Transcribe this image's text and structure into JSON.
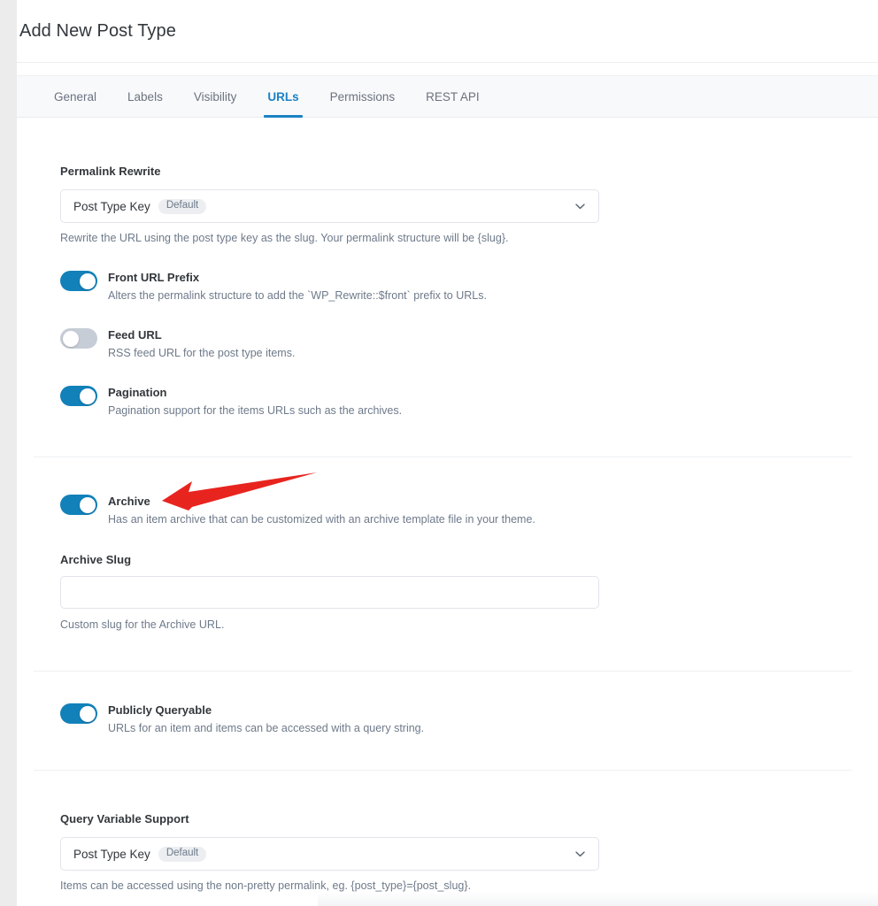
{
  "header": {
    "title": "Add New Post Type"
  },
  "tabs": [
    {
      "label": "General",
      "active": false
    },
    {
      "label": "Labels",
      "active": false
    },
    {
      "label": "Visibility",
      "active": false
    },
    {
      "label": "URLs",
      "active": true
    },
    {
      "label": "Permissions",
      "active": false
    },
    {
      "label": "REST API",
      "active": false
    }
  ],
  "fields": {
    "permalink_rewrite": {
      "label": "Permalink Rewrite",
      "value": "Post Type Key",
      "badge": "Default",
      "helper": "Rewrite the URL using the post type key as the slug. Your permalink structure will be {slug}.",
      "chevron_icon": "chevron-down-icon"
    },
    "front_url_prefix": {
      "label": "Front URL Prefix",
      "description": "Alters the permalink structure to add the `WP_Rewrite::$front` prefix to URLs.",
      "state": "on"
    },
    "feed_url": {
      "label": "Feed URL",
      "description": "RSS feed URL for the post type items.",
      "state": "off"
    },
    "pagination": {
      "label": "Pagination",
      "description": "Pagination support for the items URLs such as the archives.",
      "state": "on"
    },
    "archive": {
      "label": "Archive",
      "description": "Has an item archive that can be customized with an archive template file in your theme.",
      "state": "on"
    },
    "archive_slug": {
      "label": "Archive Slug",
      "value": "",
      "placeholder": "",
      "helper": "Custom slug for the Archive URL."
    },
    "publicly_queryable": {
      "label": "Publicly Queryable",
      "description": "URLs for an item and items can be accessed with a query string.",
      "state": "on"
    },
    "query_variable_support": {
      "label": "Query Variable Support",
      "value": "Post Type Key",
      "badge": "Default",
      "helper": "Items can be accessed using the non-pretty permalink, eg. {post_type}={post_slug}.",
      "chevron_icon": "chevron-down-icon"
    }
  },
  "annotation": {
    "name": "red-arrow-pointing-to-archive-toggle",
    "color": "#e8241f",
    "points_to": "Archive"
  },
  "colors": {
    "accent": "#1b82c4",
    "toggle_on": "#1281b9",
    "toggle_off": "#c7cdd6",
    "text_primary": "#32373c",
    "text_muted": "#6e7a8a",
    "border": "#e2e4ea",
    "tabbar_bg": "#f8f9fa",
    "annotation_red": "#e8241f"
  }
}
